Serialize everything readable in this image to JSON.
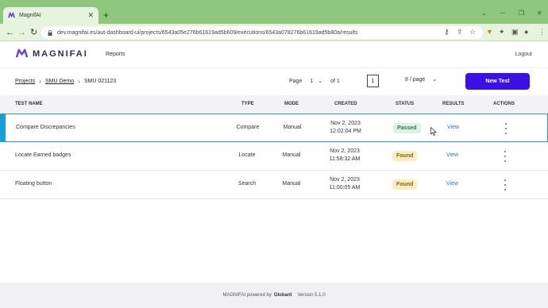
{
  "browser": {
    "tab_title": "MagnifAI",
    "url": "dev.magnifai.es/aut-dashboard-ui/projects/6543a05e276b61619ad5b609/executions/6543a078276b61619ad5b80a/results"
  },
  "app": {
    "logo_text": "MAGNIFAI",
    "nav_reports": "Reports",
    "logout": "Logout",
    "accent_color": "#3a10e5"
  },
  "breadcrumb": {
    "projects": "Projects",
    "demo": "SMU Demo",
    "current": "SMU 021123"
  },
  "pager": {
    "page_label": "Page",
    "page_value": "1",
    "of_label": "of 1",
    "page_box": "1",
    "per_page": "8 / page"
  },
  "new_test_button": "New Test",
  "table": {
    "headers": {
      "name": "TEST NAME",
      "type": "TYPE",
      "mode": "MODE",
      "created": "CREATED",
      "status": "STATUS",
      "results": "RESULTS",
      "actions": "ACTIONS"
    },
    "rows": [
      {
        "name": "Compare Discrepancies",
        "type": "Compare",
        "mode": "Manual",
        "date": "Nov 2, 2023",
        "time": "12:02:04 PM",
        "status": "Passed",
        "result": "View"
      },
      {
        "name": "Locate Earned badges",
        "type": "Locate",
        "mode": "Manual",
        "date": "Nov 2, 2023",
        "time": "11:58:32 AM",
        "status": "Found",
        "result": "View"
      },
      {
        "name": "Floating button",
        "type": "Search",
        "mode": "Manual",
        "date": "Nov 2, 2023",
        "time": "11:00:05 AM",
        "status": "Found",
        "result": "View"
      }
    ]
  },
  "footer": {
    "prefix": "MAGNIFAI powered by",
    "company": "Globant",
    "version": "Version 5.1.0"
  }
}
